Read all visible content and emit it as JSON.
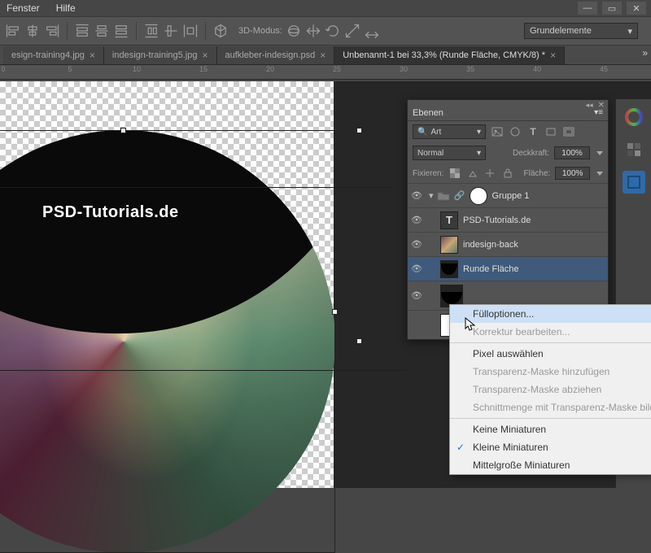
{
  "menu": {
    "window": "Fenster",
    "help": "Hilfe"
  },
  "toolbar": {
    "mode_label": "3D-Modus:",
    "elements": "Grundelemente"
  },
  "tabs": [
    {
      "label": "esign-training4.jpg",
      "active": false
    },
    {
      "label": "indesign-training5.jpg",
      "active": false
    },
    {
      "label": "aufkleber-indesign.psd",
      "active": false
    },
    {
      "label": "Unbenannt-1 bei 33,3% (Runde Fläche, CMYK/8) *",
      "active": true
    }
  ],
  "ruler_ticks": [
    "0",
    "5",
    "10",
    "15",
    "20",
    "25",
    "30",
    "35",
    "40",
    "45"
  ],
  "canvas": {
    "brand": "PSD-Tutorials.de"
  },
  "panel": {
    "title": "Ebenen",
    "kind": "Art",
    "blend": "Normal",
    "opacity_label": "Deckkraft:",
    "opacity": "100%",
    "fix_label": "Fixieren:",
    "fill_label": "Fläche:",
    "fill": "100%",
    "layers": [
      {
        "name": "Gruppe 1",
        "type": "group"
      },
      {
        "name": "PSD-Tutorials.de",
        "type": "text"
      },
      {
        "name": "indesign-back",
        "type": "image"
      },
      {
        "name": "Runde Fläche",
        "type": "shape",
        "selected": true
      },
      {
        "name": "",
        "type": "shape"
      },
      {
        "name": "",
        "type": "shape"
      }
    ]
  },
  "context": {
    "items": [
      {
        "label": "Fülloptionen...",
        "hl": true
      },
      {
        "label": "Korrektur bearbeiten...",
        "disabled": true
      },
      {
        "sep": true
      },
      {
        "label": "Pixel auswählen"
      },
      {
        "label": "Transparenz-Maske hinzufügen",
        "disabled": true
      },
      {
        "label": "Transparenz-Maske abziehen",
        "disabled": true
      },
      {
        "label": "Schnittmenge mit Transparenz-Maske bilden",
        "disabled": true
      },
      {
        "sep": true
      },
      {
        "label": "Keine Miniaturen"
      },
      {
        "label": "Kleine Miniaturen",
        "checked": true
      },
      {
        "label": "Mittelgroße Miniaturen"
      }
    ]
  }
}
